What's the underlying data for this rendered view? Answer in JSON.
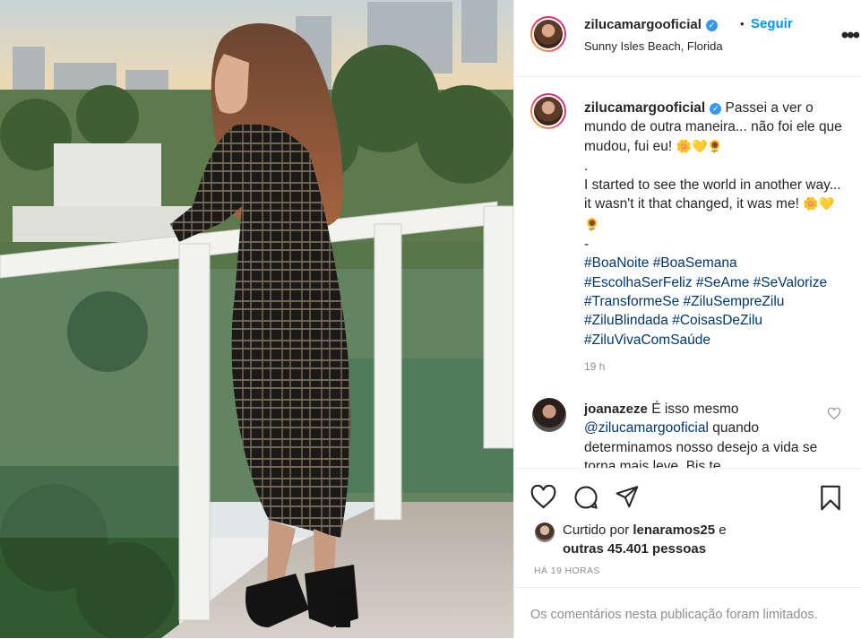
{
  "post": {
    "username": "zilucamargooficial",
    "verified": true,
    "follow_label": "Seguir",
    "separator": "•",
    "location": "Sunny Isles Beach, Florida",
    "more_icon": "more-options-icon"
  },
  "caption": {
    "username": "zilucamargooficial",
    "text_pt": "Passei a ver o mundo de outra maneira... não foi ele que mudou, fui eu! ",
    "emojis_1": "🌼💛🌻",
    "dot": ".",
    "text_en": "I started to see the world in another way... it wasn't it that changed, it was me! ",
    "emojis_2": "🌼💛🌻",
    "dash": "-",
    "hashtags": "#BoaNoite #BoaSemana #EscolhaSerFeliz #SeAme #SeValorize #TransformeSe #ZiluSempreZilu #ZiluBlindada #CoisasDeZilu #ZiluVivaComSaúde",
    "time": "19 h"
  },
  "comment": {
    "username": "joanazeze",
    "text_start": "É isso mesmo",
    "mention": "@zilucamargooficial",
    "text_rest": "quando determinamos nosso desejo a vida se torna mais leve. Bjs te"
  },
  "likes": {
    "prefix": "Curtido por",
    "user": "lenaramos25",
    "conj": "e",
    "others": "outras 45.401 pessoas"
  },
  "time_label": "HÁ 19 HORAS",
  "comments_limited": "Os comentários nesta publicação foram limitados.",
  "colors": {
    "link": "#0095f6",
    "hashtag": "#00376b",
    "muted": "#8e8e8e",
    "verified": "#3897f0"
  }
}
